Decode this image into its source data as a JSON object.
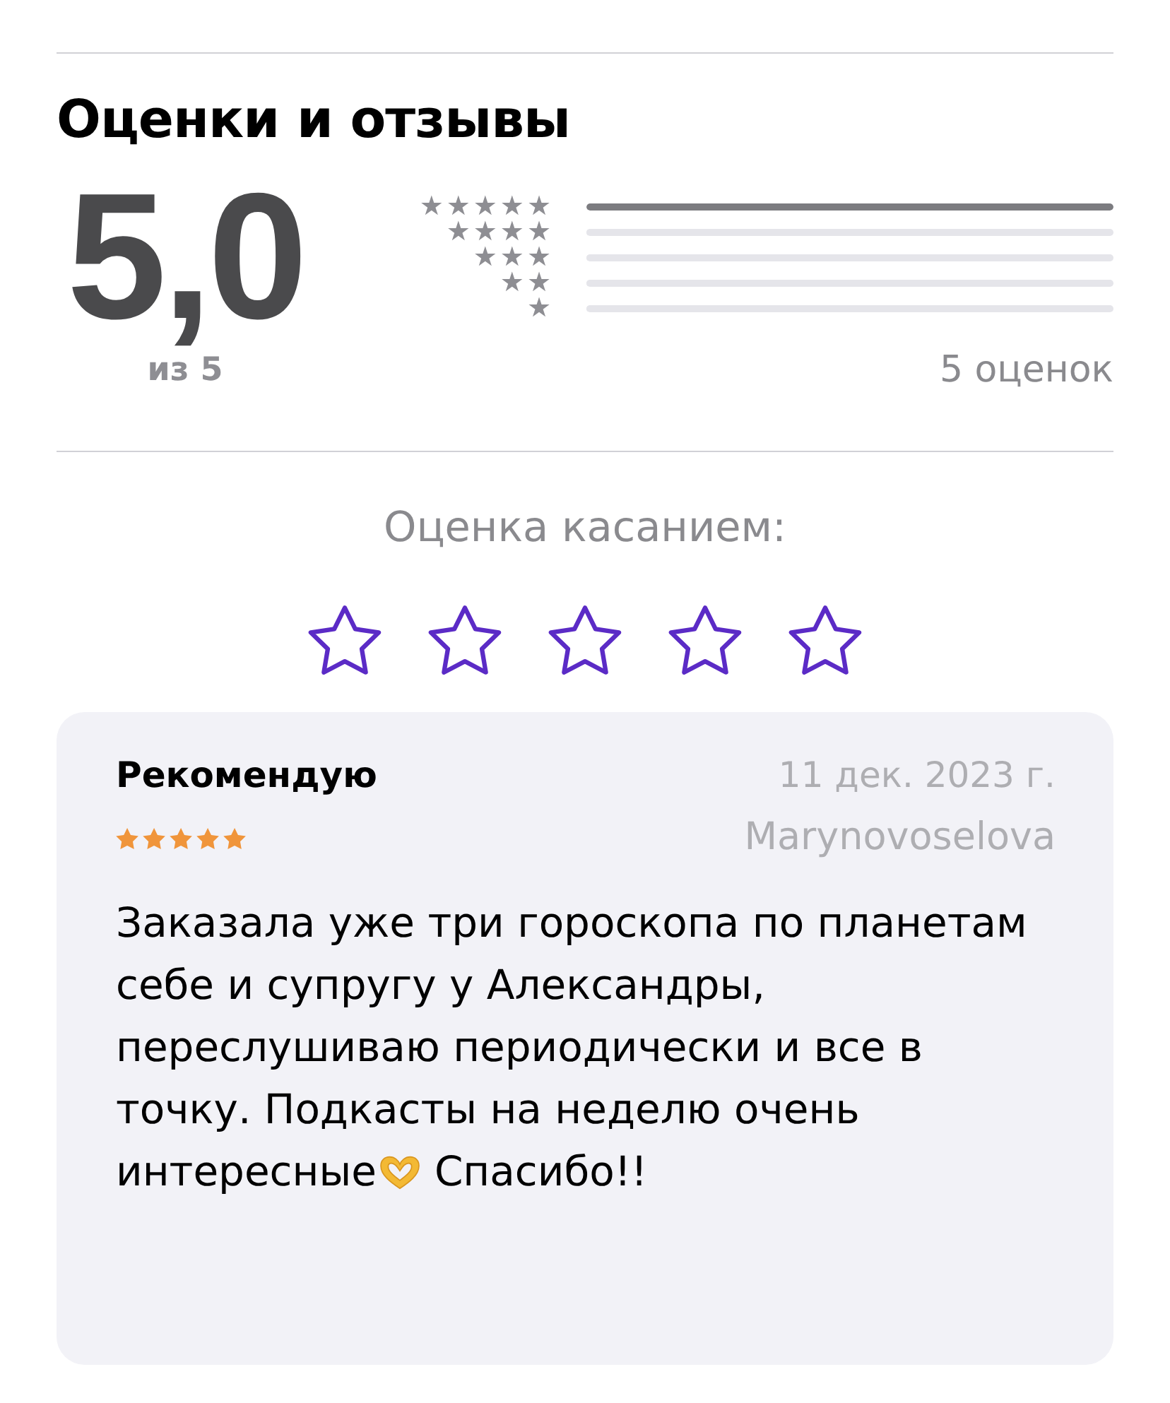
{
  "section": {
    "title": "Оценки и отзывы"
  },
  "summary": {
    "average": "5,0",
    "out_of": "из 5",
    "count": "5 оценок"
  },
  "histogram": [
    {
      "label": "★★★★★",
      "level": 1
    },
    {
      "label": "★★★★",
      "level": 0
    },
    {
      "label": "★★★",
      "level": 0
    },
    {
      "label": "★★",
      "level": 0
    },
    {
      "label": "★",
      "level": 0
    }
  ],
  "tap_rating": {
    "label": "Оценка касанием:",
    "stars": 0
  },
  "review": {
    "title": "Рекомендую",
    "date": "11 дек. 2023 г.",
    "stars": 5,
    "author": "Marynovoselova",
    "text": "Заказала уже три гороскопа по планетам себе и супругу у Александры, переслушиваю периодически и все в точку. Подкасты на неделю очень интересные",
    "closing": "Спасибо!!"
  }
}
